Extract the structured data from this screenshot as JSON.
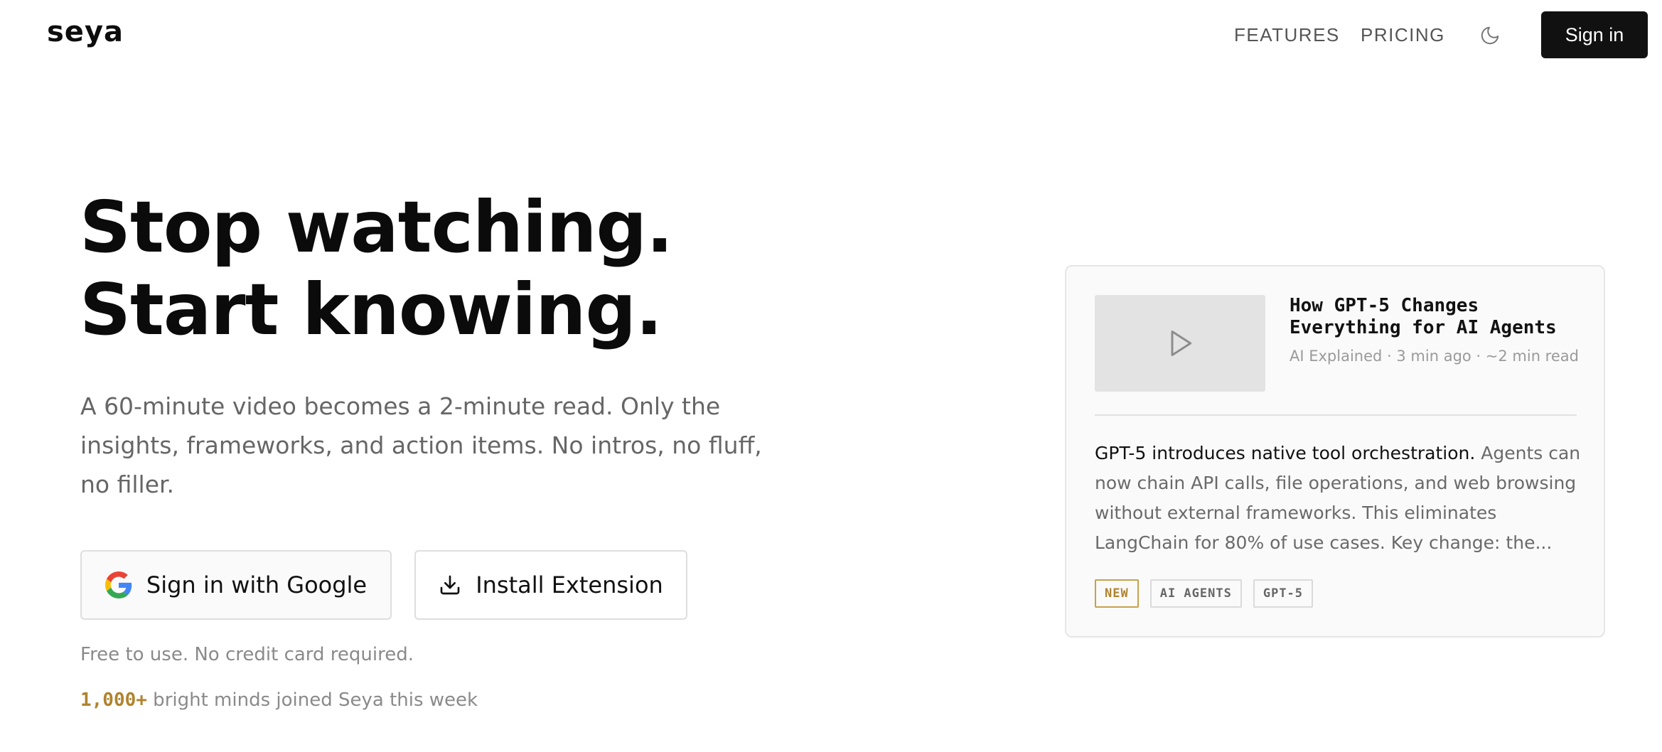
{
  "header": {
    "logo": "seya",
    "nav": [
      {
        "label": "FEATURES"
      },
      {
        "label": "PRICING"
      }
    ],
    "theme_icon": "moon-icon",
    "signin_label": "Sign in"
  },
  "hero": {
    "headline_line1": "Stop watching.",
    "headline_line2": "Start knowing.",
    "subtext": "A 60-minute video becomes a 2-minute read. Only the insights, frameworks, and action items. No intros, no fluff, no filler.",
    "google_button_label": "Sign in with Google",
    "google_icon": "google-g-icon",
    "install_button_label": "Install Extension",
    "install_icon": "download-icon",
    "free_note": "Free to use. No credit card required.",
    "joined_count": "1,000+",
    "joined_text": " bright minds joined Seya this week"
  },
  "preview_card": {
    "thumbnail_icon": "play-icon",
    "title": "How GPT-5 Changes Everything for AI Agents",
    "meta": "AI Explained · 3 min ago · ~2 min read",
    "summary_lead": "GPT-5 introduces native tool orchestration.",
    "summary_rest": " Agents can now chain API calls, file operations, and web browsing without external frameworks. This eliminates LangChain for 80% of use cases. Key change: the...",
    "tags": [
      {
        "label": "NEW"
      },
      {
        "label": "AI AGENTS"
      },
      {
        "label": "GPT-5"
      }
    ]
  },
  "colors": {
    "accent_gold": "#b0832e",
    "dark": "#111111",
    "muted": "#666666"
  }
}
